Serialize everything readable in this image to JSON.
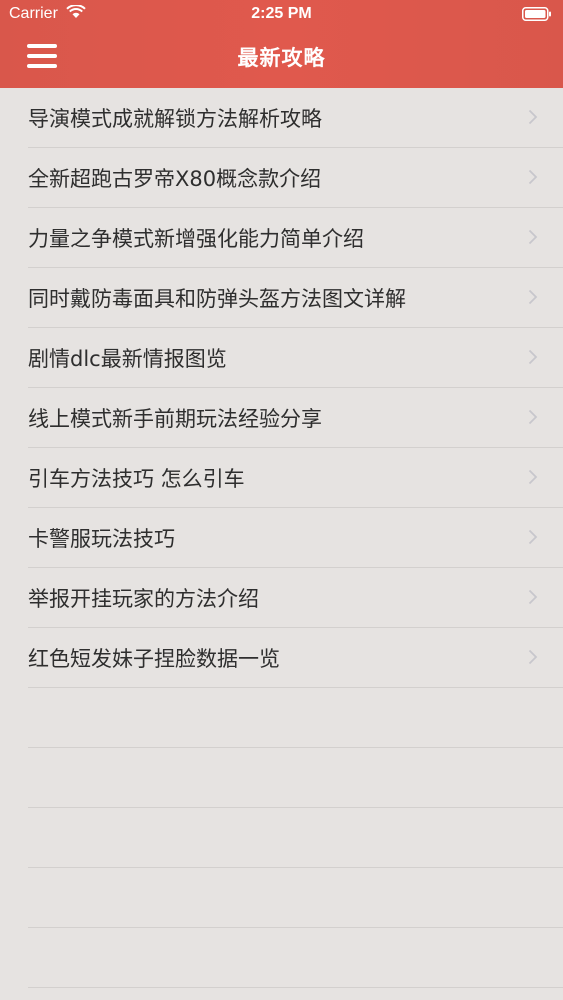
{
  "status_bar": {
    "carrier": "Carrier",
    "time": "2:25 PM"
  },
  "nav": {
    "title": "最新攻略"
  },
  "articles": [
    "导演模式成就解锁方法解析攻略",
    "全新超跑古罗帝X80概念款介绍",
    "力量之争模式新增强化能力简单介绍",
    "同时戴防毒面具和防弹头盔方法图文详解",
    "剧情dlc最新情报图览",
    "线上模式新手前期玩法经验分享",
    "引车方法技巧 怎么引车",
    "卡警服玩法技巧",
    "举报开挂玩家的方法介绍",
    "红色短发妹子捏脸数据一览"
  ],
  "colors": {
    "header": "#df584c",
    "background": "#e6e3e1",
    "separator": "#d3d0ce",
    "text": "#2e2e2e",
    "chevron": "#c7c7cc"
  },
  "icons": {
    "menu": "hamburger-menu-icon",
    "row_disclosure": "chevron-right-icon",
    "wifi": "wifi-icon",
    "battery": "battery-icon"
  }
}
